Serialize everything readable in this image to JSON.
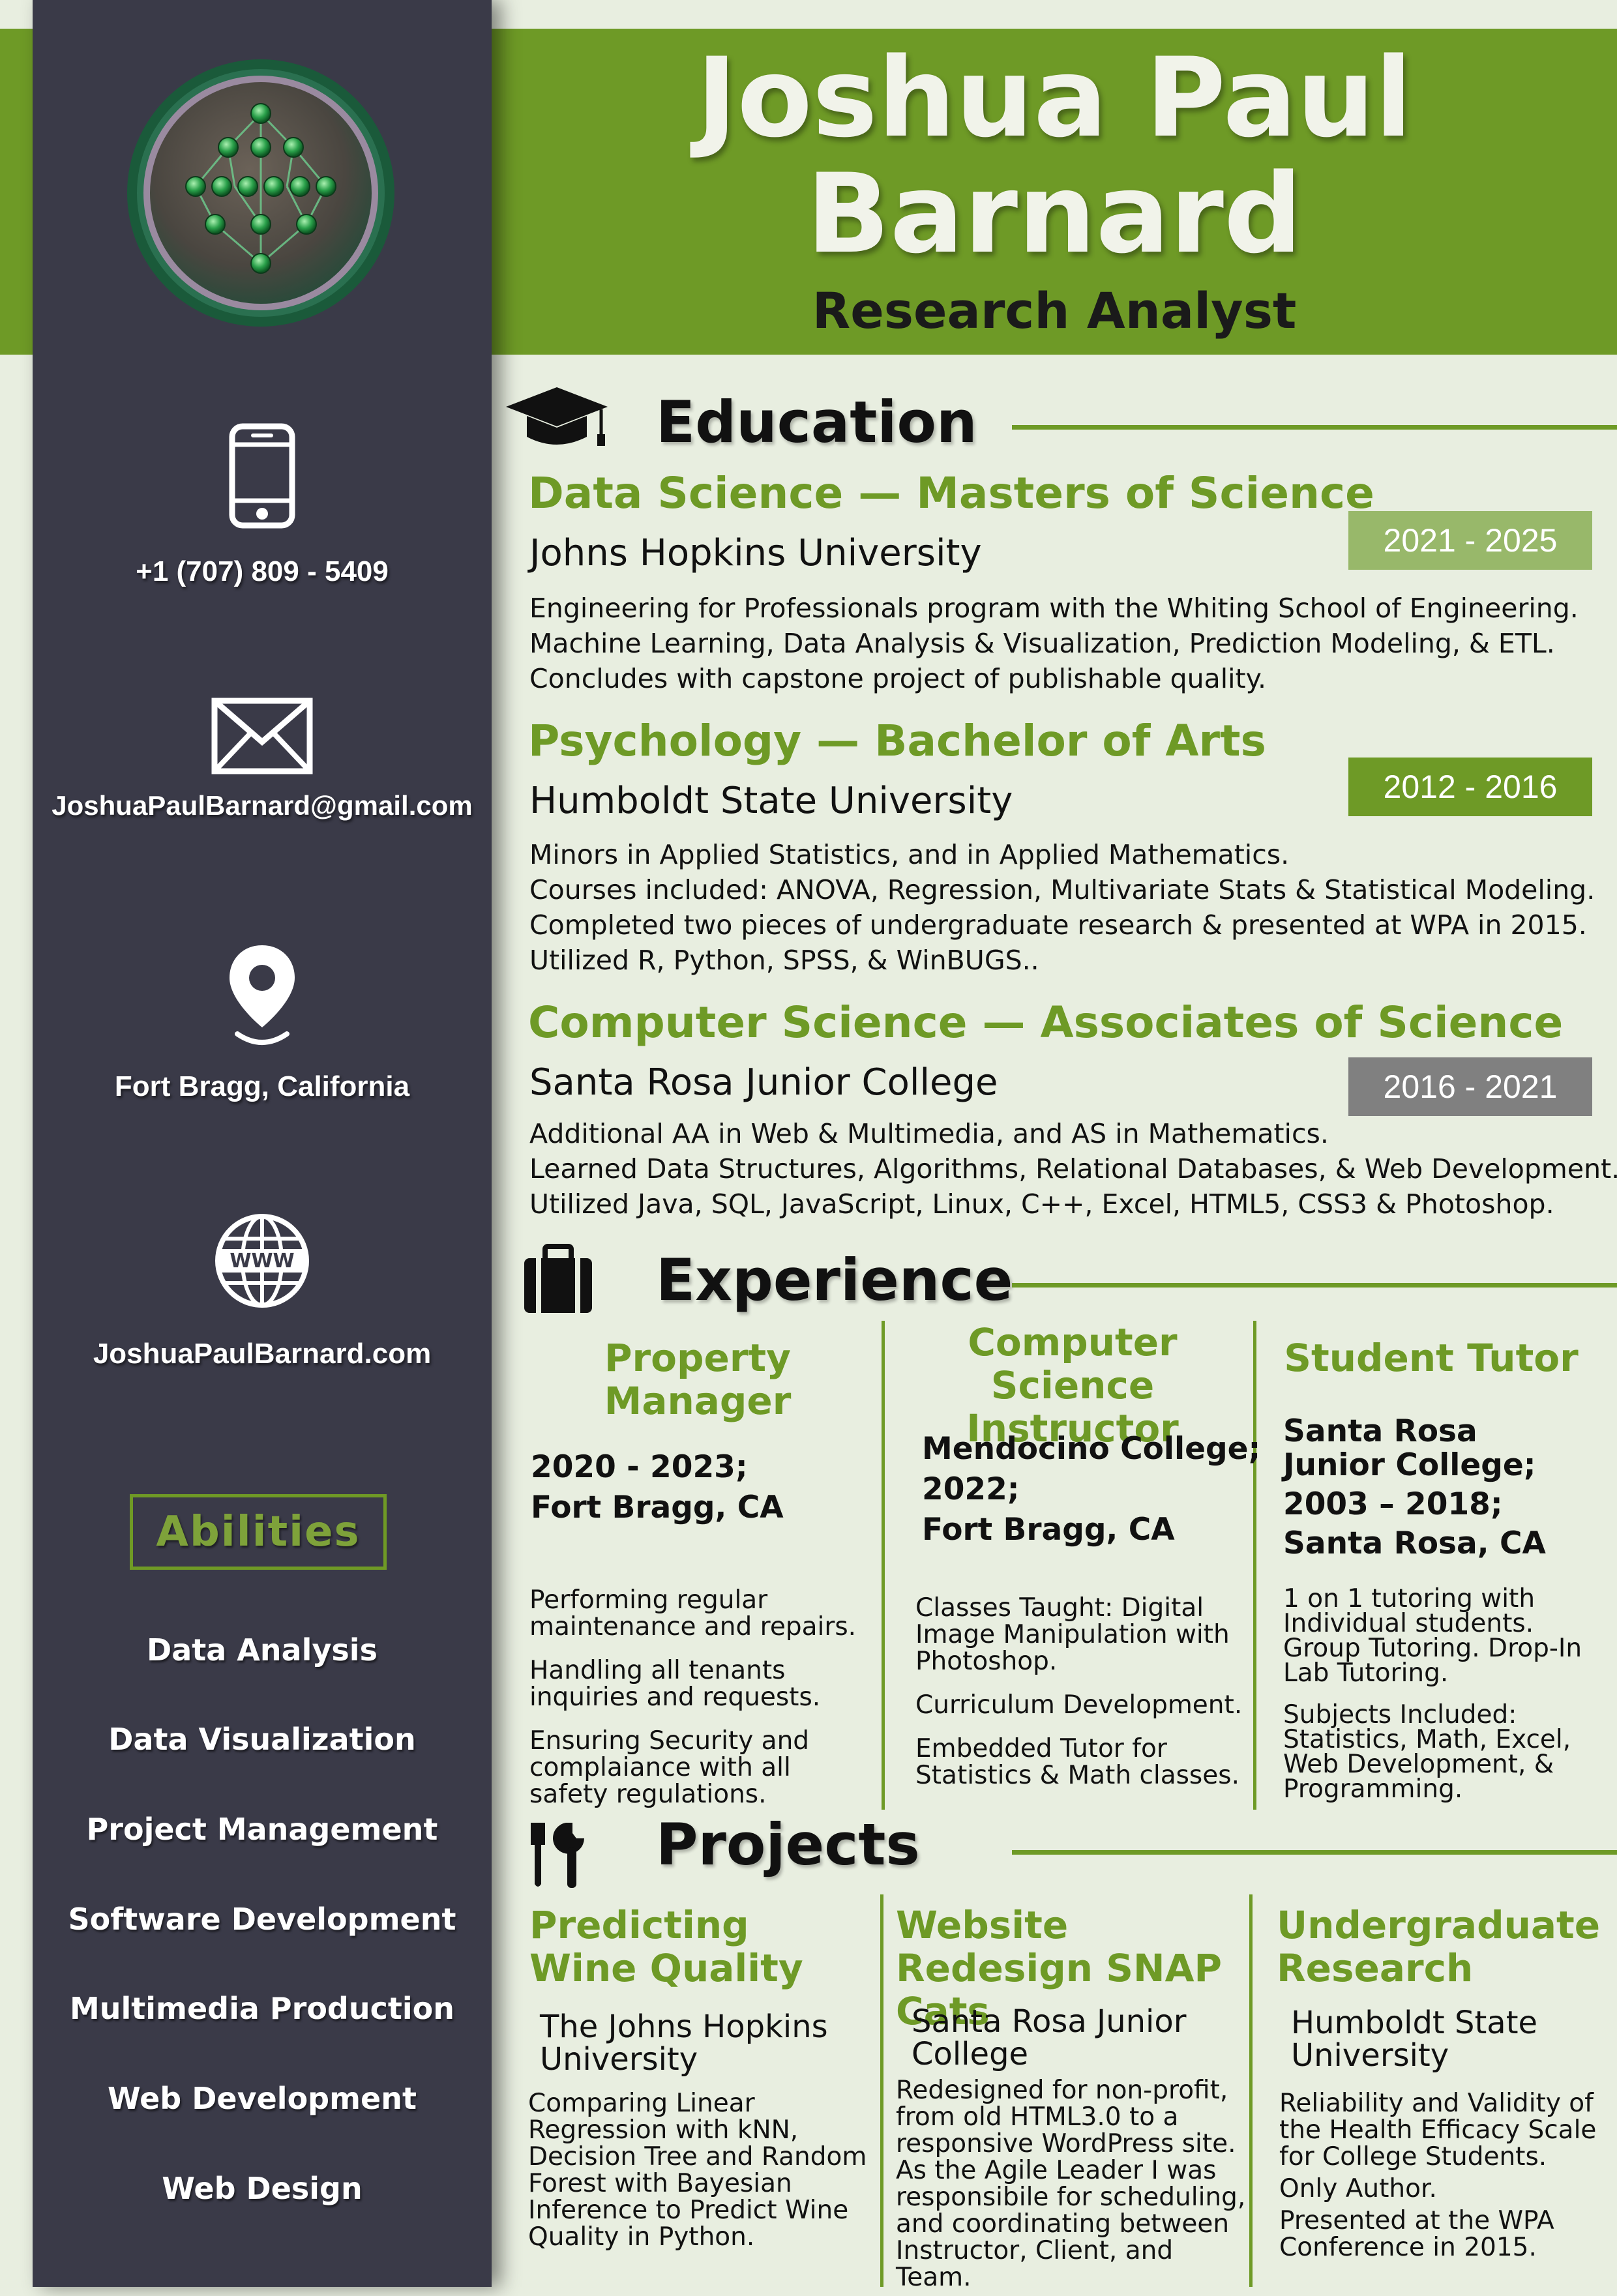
{
  "header": {
    "name_line1": "Joshua Paul",
    "name_line2": "Barnard",
    "title": "Research Analyst"
  },
  "sidebar": {
    "phone": "+1 (707) 809 - 5409",
    "email": "JoshuaPaulBarnard@gmail.com",
    "location": "Fort Bragg, California",
    "website": "JoshuaPaulBarnard.com",
    "website_icon_text": "WWW",
    "icons": [
      "neural-network-logo",
      "phone-icon",
      "envelope-icon",
      "map-pin-icon",
      "globe-icon"
    ],
    "abilities_title": "Abilities",
    "abilities": [
      "Data Analysis",
      "Data Visualization",
      "Project Management",
      "Software Development",
      "Multimedia Production",
      "Web Development",
      "Web Design"
    ]
  },
  "education": {
    "title": "Education",
    "icon": "graduation-cap-icon",
    "items": [
      {
        "degree": "Data Science — Masters of Science",
        "school": "Johns Hopkins University",
        "years": "2021 - 2025",
        "year_color": "#98b86a",
        "lines": [
          "Engineering for Professionals program with the Whiting School of Engineering.",
          "Machine Learning, Data Analysis & Visualization, Prediction Modeling, & ETL.",
          "Concludes with capstone project of publishable quality."
        ]
      },
      {
        "degree": "Psychology — Bachelor of Arts",
        "school": "Humboldt State University",
        "years": "2012 - 2016",
        "year_color": "#6e9a26",
        "lines": [
          "Minors in Applied Statistics, and in Applied Mathematics.",
          "Courses included: ANOVA, Regression, Multivariate Stats & Statistical Modeling.",
          "Completed two pieces of undergraduate research & presented at WPA in 2015.",
          "Utilized R, Python, SPSS, & WinBUGS.."
        ]
      },
      {
        "degree": "Computer Science — Associates of Science",
        "school": "Santa Rosa Junior College",
        "years": "2016 - 2021",
        "year_color": "#808080",
        "lines": [
          "Additional AA in Web & Multimedia, and AS in Mathematics.",
          "Learned Data Structures, Algorithms, Relational Databases, & Web Development.",
          "Utilized Java, SQL, JavaScript, Linux, C++, Excel, HTML5, CSS3 & Photoshop."
        ]
      }
    ]
  },
  "experience": {
    "title": "Experience",
    "icon": "briefcase-icon",
    "jobs": [
      {
        "title": "Property Manager",
        "details": [
          "2020 - 2023;",
          "Fort Bragg, CA"
        ],
        "bullets": [
          "Performing regular maintenance and repairs.",
          "Handling all tenants inquiries and requests.",
          "Ensuring Security and complaiance with all safety regulations."
        ]
      },
      {
        "title": "Computer Science Instructor",
        "details": [
          "Mendocino College;",
          "2022;",
          "Fort Bragg, CA"
        ],
        "bullets": [
          "Classes Taught:  Digital Image Manipulation with Photoshop.",
          "Curriculum Development.",
          "Embedded Tutor for Statistics & Math classes."
        ]
      },
      {
        "title": "Student Tutor",
        "details": [
          "Santa Rosa",
          "Junior College;",
          "2003 – 2018;",
          "Santa Rosa, CA"
        ],
        "bullets": [
          "1 on 1 tutoring with Individual students. Group Tutoring. Drop-In Lab Tutoring.",
          "Subjects Included: Statistics, Math, Excel, Web Development, & Programming."
        ]
      }
    ]
  },
  "projects": {
    "title": "Projects",
    "icon": "tools-icon",
    "items": [
      {
        "title": "Predicting Wine Quality",
        "org": "The Johns Hopkins University",
        "paras": [
          "Comparing Linear Regression with kNN, Decision Tree and Random Forest with Bayesian Inference to Predict Wine Quality in Python."
        ]
      },
      {
        "title": "Website Redesign SNAP Cats",
        "org": "Santa Rosa Junior College",
        "paras": [
          "Redesigned for non-profit, from old HTML3.0 to a responsive WordPress site. As the Agile Leader I was responsibile for scheduling, and coordinating between Instructor, Client, and Team."
        ]
      },
      {
        "title": "Undergraduate Research",
        "org": "Humboldt State University",
        "paras": [
          "Reliability and Validity of the Health Efficacy Scale for College Students.",
          "Only Author.",
          "Presented at the WPA Conference in 2015."
        ]
      }
    ]
  },
  "colors": {
    "accent_green": "#6e9a26",
    "sidebar_bg": "#3a3a48",
    "page_bg": "#e8eee0"
  }
}
